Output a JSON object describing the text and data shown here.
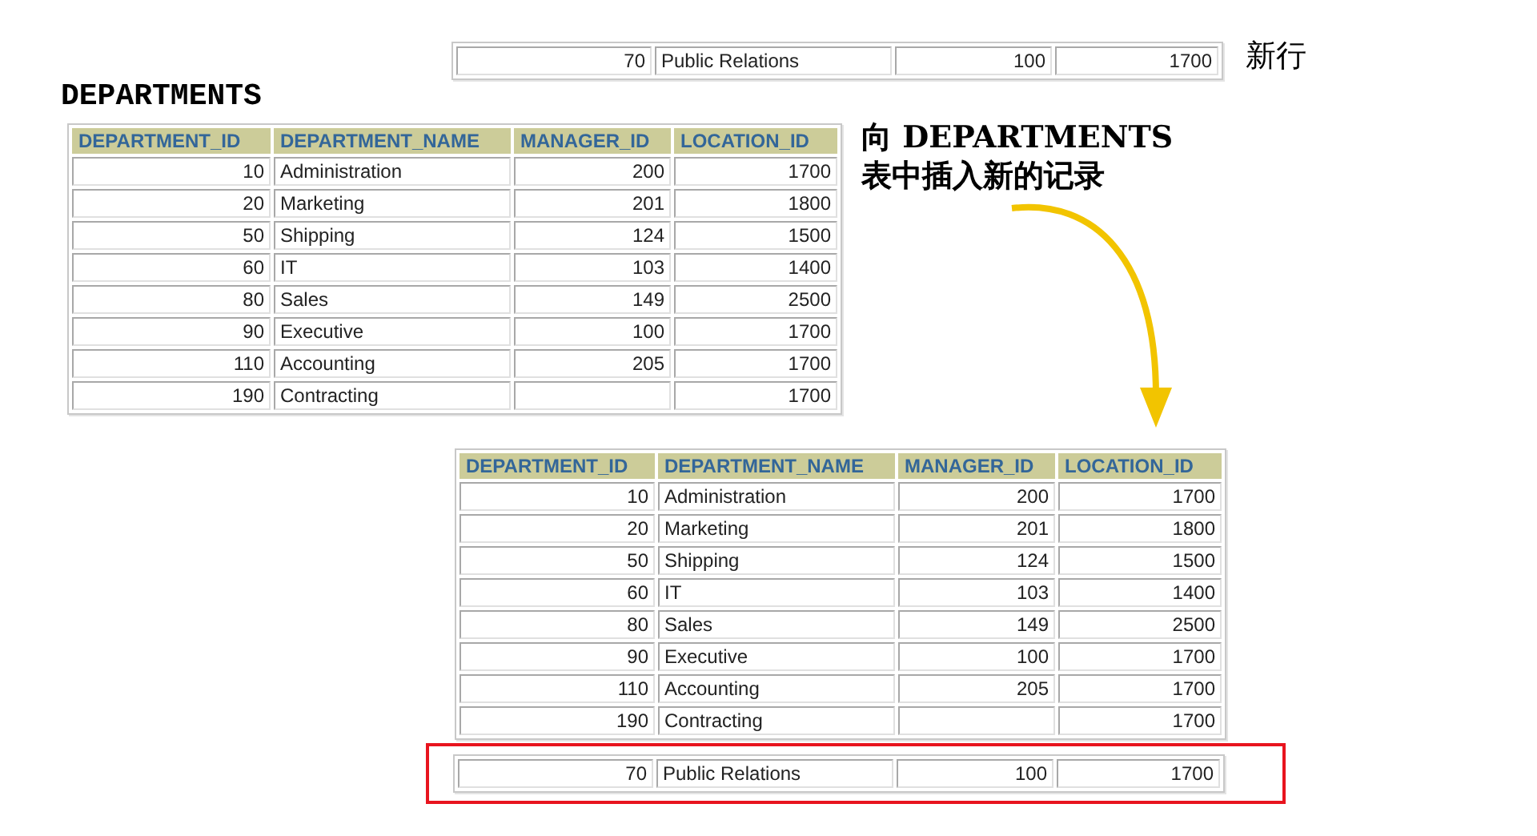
{
  "new_row": {
    "label": "新行",
    "cells": [
      "70",
      "Public Relations",
      "100",
      "1700"
    ]
  },
  "source_table": {
    "title": "DEPARTMENTS",
    "columns": [
      {
        "label": "DEPARTMENT_ID",
        "kind": "number"
      },
      {
        "label": "DEPARTMENT_NAME",
        "kind": "text"
      },
      {
        "label": "MANAGER_ID",
        "kind": "number"
      },
      {
        "label": "LOCATION_ID",
        "kind": "number"
      }
    ],
    "rows": [
      [
        "10",
        "Administration",
        "200",
        "1700"
      ],
      [
        "20",
        "Marketing",
        "201",
        "1800"
      ],
      [
        "50",
        "Shipping",
        "124",
        "1500"
      ],
      [
        "60",
        "IT",
        "103",
        "1400"
      ],
      [
        "80",
        "Sales",
        "149",
        "2500"
      ],
      [
        "90",
        "Executive",
        "100",
        "1700"
      ],
      [
        "110",
        "Accounting",
        "205",
        "1700"
      ],
      [
        "190",
        "Contracting",
        null,
        "1700"
      ]
    ]
  },
  "callout": {
    "lines": [
      "向 DEPARTMENTS",
      "表中插入新的记录"
    ]
  },
  "result_table": {
    "columns": [
      {
        "label": "DEPARTMENT_ID",
        "kind": "number"
      },
      {
        "label": "DEPARTMENT_NAME",
        "kind": "text"
      },
      {
        "label": "MANAGER_ID",
        "kind": "number"
      },
      {
        "label": "LOCATION_ID",
        "kind": "number"
      }
    ],
    "rows": [
      [
        "10",
        "Administration",
        "200",
        "1700"
      ],
      [
        "20",
        "Marketing",
        "201",
        "1800"
      ],
      [
        "50",
        "Shipping",
        "124",
        "1500"
      ],
      [
        "60",
        "IT",
        "103",
        "1400"
      ],
      [
        "80",
        "Sales",
        "149",
        "2500"
      ],
      [
        "90",
        "Executive",
        "100",
        "1700"
      ],
      [
        "110",
        "Accounting",
        "205",
        "1700"
      ],
      [
        "190",
        "Contracting",
        null,
        "1700"
      ]
    ],
    "inserted_row": {
      "cells": [
        "70",
        "Public Relations",
        "100",
        "1700"
      ],
      "highlighted": true
    }
  }
}
